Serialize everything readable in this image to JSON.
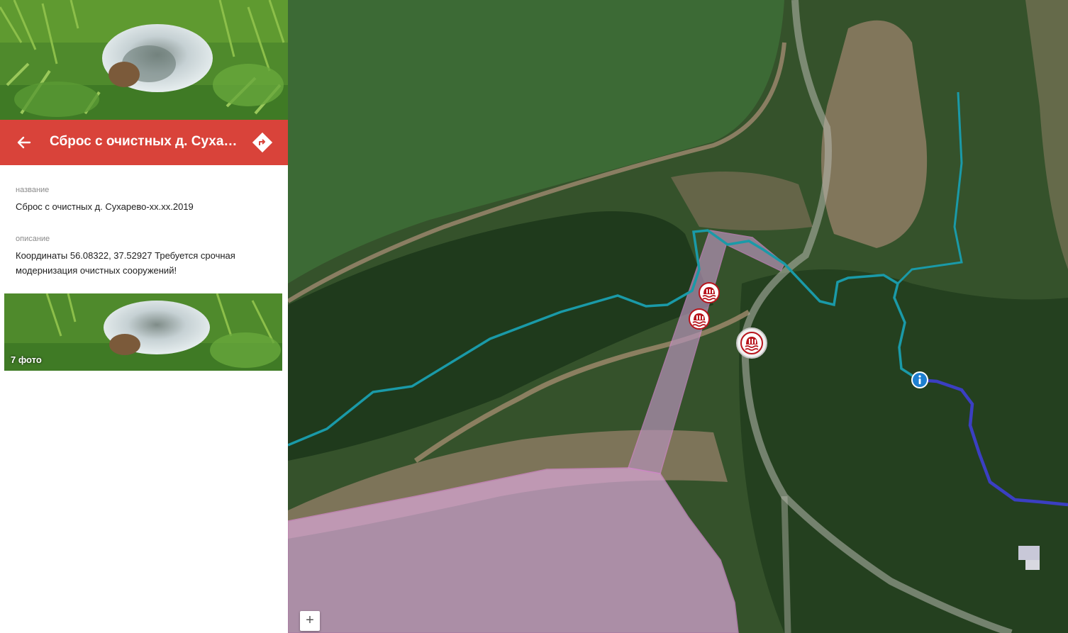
{
  "place": {
    "title": "Сброс с очистных д. Сухар…",
    "name_label": "название",
    "name_value": "Сброс с очистных д. Сухарево-хх.хх.2019",
    "desc_label": "описание",
    "desc_value": "Координаты 56.08322, 37.52927 Требуется срочная модернизация очистных сооружений!",
    "photo_count": "7 фото"
  },
  "map": {
    "zoom_in_label": "+",
    "colors": {
      "header": "#d9433a",
      "river": "#1a9aa8",
      "river_dark": "#3b3fc2",
      "area_fill": "#d9a6d6",
      "area_stroke": "#d58ad0",
      "marker": "#b8141c",
      "info_marker": "#1e7fd0"
    },
    "icons": [
      "back-arrow-icon",
      "directions-icon",
      "water-discharge-icon",
      "info-icon",
      "zoom-in-icon"
    ]
  }
}
